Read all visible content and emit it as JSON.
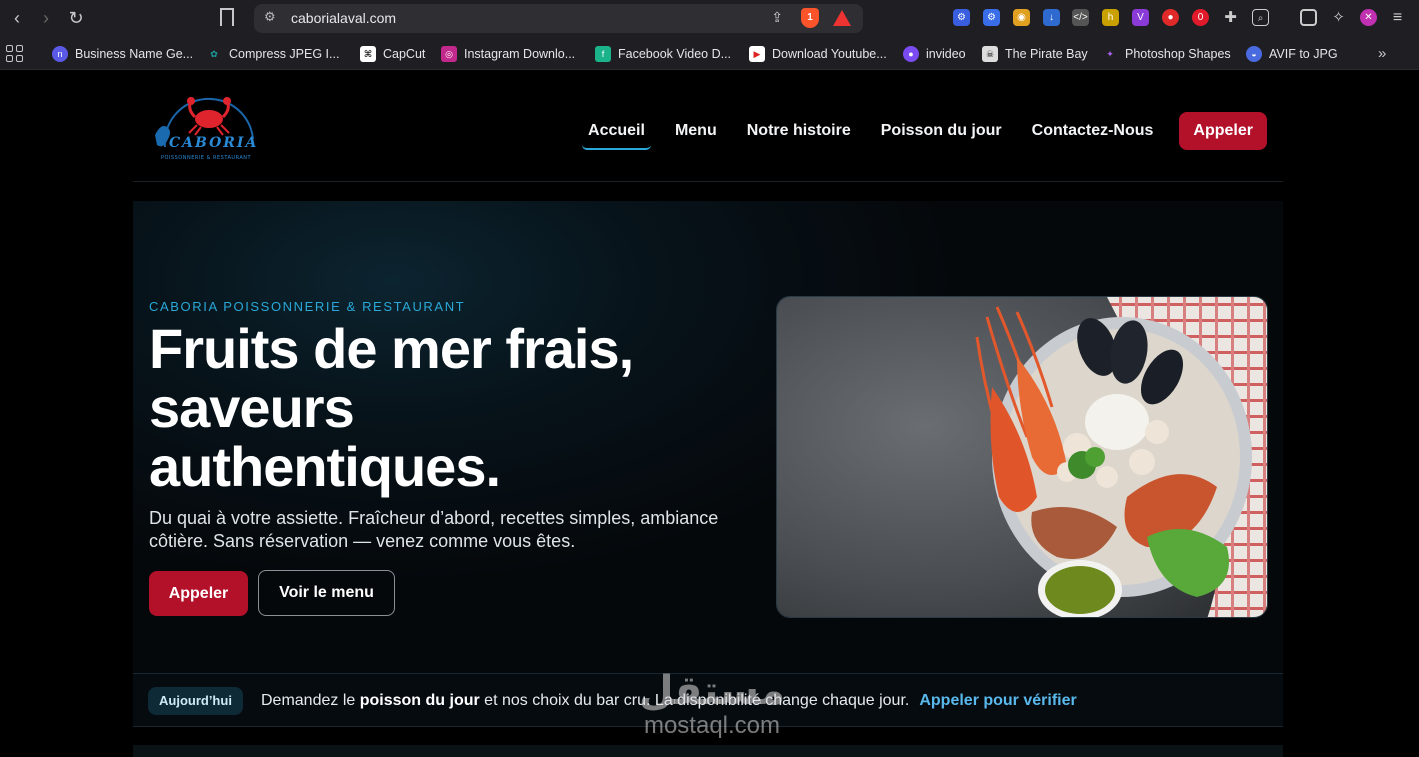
{
  "browser": {
    "url": "caborialaval.com",
    "brave_badge": "1",
    "bookmarks": [
      {
        "label": "Business Name Ge...",
        "color": "#5a5ae6",
        "glyph": "n"
      },
      {
        "label": "Compress JPEG I...",
        "color": "#1aa2a2",
        "glyph": "✿"
      },
      {
        "label": "CapCut",
        "color": "#ffffff",
        "glyph": "⌘"
      },
      {
        "label": "Instagram Downlo...",
        "color": "#c2298c",
        "glyph": "◎"
      },
      {
        "label": "Facebook Video D...",
        "color": "#1ab38a",
        "glyph": "f"
      },
      {
        "label": "Download Youtube...",
        "color": "#d22",
        "glyph": "▶"
      },
      {
        "label": "invideo",
        "color": "#7b4bf2",
        "glyph": "●"
      },
      {
        "label": "The Pirate Bay",
        "color": "#dddddd",
        "glyph": "☠"
      },
      {
        "label": "Photoshop Shapes",
        "color": "#8a3ad6",
        "glyph": "✦"
      },
      {
        "label": "AVIF to JPG",
        "color": "#4a6ae0",
        "glyph": "◒"
      }
    ]
  },
  "site": {
    "logo_text": "CABORIA",
    "logo_subtext": "POISSONNERIE & RESTAURANT",
    "nav": {
      "items": [
        "Accueil",
        "Menu",
        "Notre histoire",
        "Poisson du jour",
        "Contactez-Nous"
      ],
      "call": "Appeler"
    },
    "hero": {
      "eyebrow": "CABORIA POISSONNERIE & RESTAURANT",
      "title_line1": "Fruits de mer frais,",
      "title_line2": "saveurs",
      "title_line3": "authentiques.",
      "subtitle": "Du quai à votre assiette. Fraîcheur d’abord, recettes simples, ambiance côtière. Sans réservation — venez comme vous êtes.",
      "primary_button": "Appeler",
      "secondary_button": "Voir le menu"
    },
    "today": {
      "badge": "Aujourd’hui",
      "text_before": "Demandez le ",
      "text_bold": "poisson du jour",
      "text_after": " et nos choix du bar cru. La disponibilité change chaque jour.",
      "link": "Appeler pour vérifier"
    }
  },
  "watermark": {
    "arabic": "مستقل",
    "latin": "mostaql.com"
  },
  "colors": {
    "accent_red": "#b3102a",
    "accent_blue": "#2aa8d8",
    "link_blue": "#59b8ec"
  }
}
